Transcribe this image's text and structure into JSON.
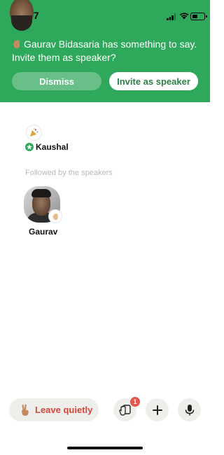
{
  "status_bar": {
    "time": "19:37"
  },
  "banner": {
    "message": "Gaurav Bidasaria has something to say. Invite them as speaker?",
    "dismiss_label": "Dismiss",
    "invite_label": "Invite as speaker",
    "accent_color": "#2ea85b"
  },
  "speakers": [
    {
      "name": "Kaushal",
      "moderator": true,
      "badge_icon": "party-popper-icon"
    }
  ],
  "followed_section": {
    "label": "Followed by the speakers",
    "users": [
      {
        "name": "Gaurav",
        "badge_icon": "raised-hand-icon"
      }
    ]
  },
  "bottom_bar": {
    "leave_label": "Leave quietly",
    "leave_color": "#d4453a",
    "raise_hand_count": "1"
  }
}
